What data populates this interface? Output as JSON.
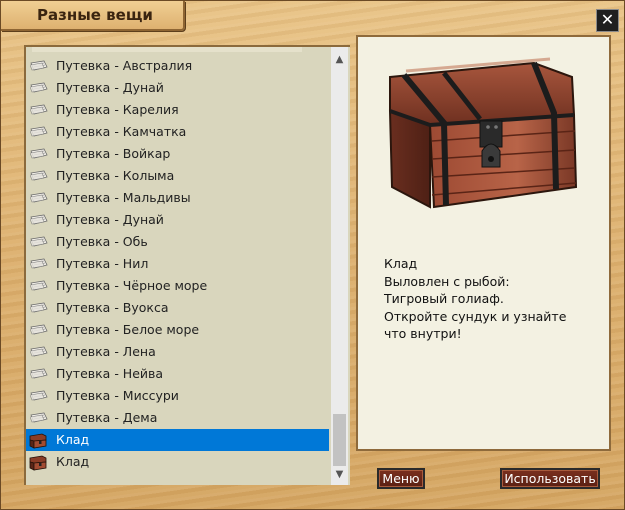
{
  "window": {
    "title": "Разные вещи",
    "close_symbol": "✕"
  },
  "list": {
    "items": [
      {
        "label": "Путевка - Австралия",
        "icon": "ticket-icon",
        "selected": false
      },
      {
        "label": "Путевка - Дунай",
        "icon": "ticket-icon",
        "selected": false
      },
      {
        "label": "Путевка - Карелия",
        "icon": "ticket-icon",
        "selected": false
      },
      {
        "label": "Путевка - Камчатка",
        "icon": "ticket-icon",
        "selected": false
      },
      {
        "label": "Путевка - Войкар",
        "icon": "ticket-icon",
        "selected": false
      },
      {
        "label": "Путевка - Колыма",
        "icon": "ticket-icon",
        "selected": false
      },
      {
        "label": "Путевка - Мальдивы",
        "icon": "ticket-icon",
        "selected": false
      },
      {
        "label": "Путевка - Дунай",
        "icon": "ticket-icon",
        "selected": false
      },
      {
        "label": "Путевка - Обь",
        "icon": "ticket-icon",
        "selected": false
      },
      {
        "label": "Путевка - Нил",
        "icon": "ticket-icon",
        "selected": false
      },
      {
        "label": "Путевка - Чёрное море",
        "icon": "ticket-icon",
        "selected": false
      },
      {
        "label": "Путевка - Вуокса",
        "icon": "ticket-icon",
        "selected": false
      },
      {
        "label": "Путевка - Белое море",
        "icon": "ticket-icon",
        "selected": false
      },
      {
        "label": "Путевка - Лена",
        "icon": "ticket-icon",
        "selected": false
      },
      {
        "label": "Путевка - Нейва",
        "icon": "ticket-icon",
        "selected": false
      },
      {
        "label": "Путевка - Миссури",
        "icon": "ticket-icon",
        "selected": false
      },
      {
        "label": "Путевка - Дема",
        "icon": "ticket-icon",
        "selected": false
      },
      {
        "label": "Клад",
        "icon": "treasure-chest-icon",
        "selected": true
      },
      {
        "label": "Клад",
        "icon": "treasure-chest-icon",
        "selected": false
      }
    ],
    "scroll_up": "▲",
    "scroll_down": "▼"
  },
  "detail": {
    "image_icon": "treasure-chest-image",
    "lines": [
      "Клад",
      "Выловлен с рыбой:",
      "Тигровый голиаф.",
      "Откройте сундук и узнайте",
      "что внутри!"
    ]
  },
  "buttons": {
    "menu_label": "Меню",
    "use_label": "Использовать"
  },
  "colors": {
    "selection": "#0078d7",
    "button_bg": "#6b2718",
    "panel_bg": "#d9d6bd"
  }
}
